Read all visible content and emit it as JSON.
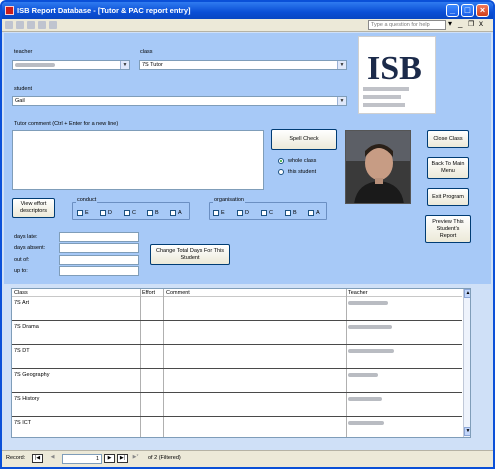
{
  "window": {
    "title": "ISB Report Database - [Tutor & PAC report entry]"
  },
  "menubar": {
    "help_placeholder": "Type a question for help",
    "minimize": "_",
    "restore": "❐",
    "close": "x"
  },
  "form": {
    "teacher_label": "teacher",
    "class_label": "class",
    "class_value": "7S Tutor",
    "student_label": "student",
    "student_value": "Gail",
    "tutor_comment_label": "Tutor comment (Ctrl + Enter for a new line)",
    "spell_check": "Spell Check",
    "radio_whole_class": "whole class",
    "radio_this_student": "this student",
    "close_class": "Close Class",
    "back_to_main": "Back To Main Menu",
    "exit_program": "Exit Program",
    "preview_report": "Preview This Student's Report",
    "view_effort": "View effort descriptors",
    "conduct_label": "conduct",
    "organisation_label": "organisation",
    "grades": [
      "E",
      "D",
      "C",
      "B",
      "A"
    ],
    "days_late_label": "days late:",
    "days_absent_label": "days absent:",
    "out_of_label": "out of:",
    "up_to_label": "up to:",
    "change_total_days": "Change Total Days For This Student"
  },
  "grid": {
    "headers": {
      "class": "Class",
      "effort": "Effort",
      "comment": "Comment",
      "teacher": "Teacher"
    },
    "rows": [
      {
        "class": "7S Art"
      },
      {
        "class": "7S Drama"
      },
      {
        "class": "7S DT"
      },
      {
        "class": "7S Geography"
      },
      {
        "class": "7S History"
      },
      {
        "class": "7S ICT"
      }
    ]
  },
  "recordbar": {
    "label": "Record:",
    "current": "1",
    "of_text": "of  2 (Filtered)"
  },
  "colors": {
    "titlebar": "#0a4fd6",
    "form_bg": "#a7c9f7",
    "window_bg": "#cfe0f7"
  }
}
